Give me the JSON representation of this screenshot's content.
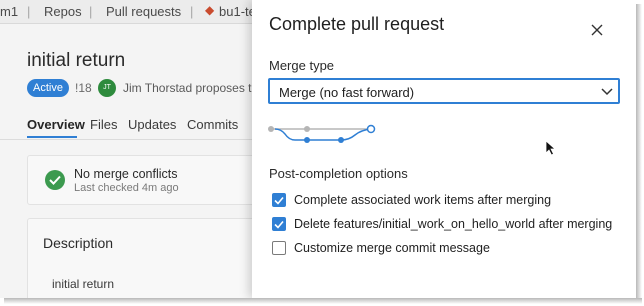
{
  "breadcrumbs": {
    "project": "m1",
    "repos": "Repos",
    "pull_requests": "Pull requests",
    "branch": "bu1-te"
  },
  "pr": {
    "title": "initial return",
    "status": "Active",
    "id": "!18",
    "avatar_initials": "JT",
    "proposer_text": "Jim Thorstad proposes to",
    "tabs": [
      "Overview",
      "Files",
      "Updates",
      "Commits"
    ],
    "active_tab": "Overview",
    "merge_status": "No merge conflicts",
    "last_checked": "Last checked 4m ago",
    "description_heading": "Description",
    "description_body": "initial return"
  },
  "dialog": {
    "title": "Complete pull request",
    "merge_type_label": "Merge type",
    "merge_type_value": "Merge (no fast forward)",
    "post_completion_label": "Post-completion options",
    "options": [
      {
        "label": "Complete associated work items after merging",
        "checked": true
      },
      {
        "label": "Delete features/initial_work_on_hello_world after merging",
        "checked": true
      },
      {
        "label": "Customize merge commit message",
        "checked": false
      }
    ]
  },
  "icons": {
    "close": "close-icon",
    "chevron": "chevron-down-icon",
    "check_circle": "check-circle-icon",
    "branch": "branch-icon",
    "merge_graph": "merge-graph-icon",
    "cursor": "mouse-cursor-icon"
  },
  "colors": {
    "accent": "#2f7fd4",
    "success": "#3c9a4f",
    "avatar": "#2e8b3d",
    "branch_icon": "#c94b2e"
  }
}
